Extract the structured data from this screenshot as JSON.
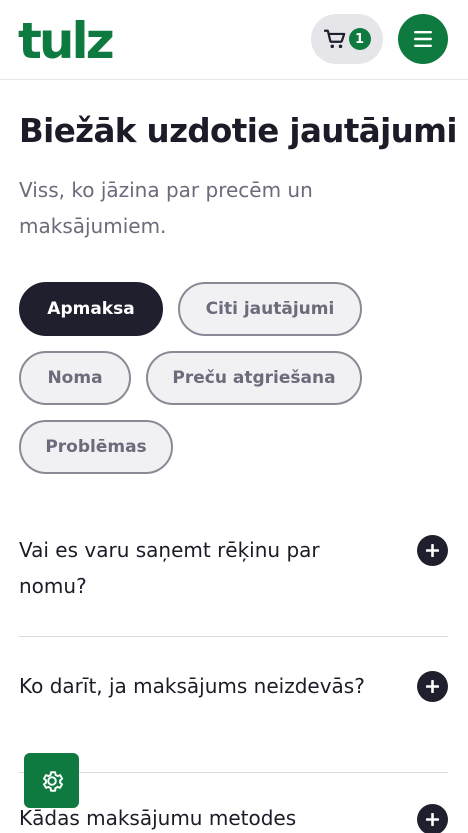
{
  "header": {
    "logo_text": "tulz",
    "cart": {
      "count": "1",
      "icon": "cart-icon"
    },
    "menu": {
      "icon": "hamburger-menu-icon"
    }
  },
  "page": {
    "title": "Biežāk uzdotie jautājumi",
    "subtitle": "Viss, ko jāzina par precēm un maksājumiem."
  },
  "categories": [
    {
      "label": "Apmaksa",
      "active": true
    },
    {
      "label": "Citi jautājumi",
      "active": false
    },
    {
      "label": "Noma",
      "active": false
    },
    {
      "label": "Preču atgriešana",
      "active": false
    },
    {
      "label": "Problēmas",
      "active": false
    }
  ],
  "faq": [
    {
      "question": "Vai es varu saņemt rēķinu par nomu?",
      "icon": "plus-icon"
    },
    {
      "question": "Ko darīt, ja maksājums neizdevās?",
      "icon": "plus-icon"
    },
    {
      "question": "Kādas maksājumu metodes",
      "icon": "plus-icon"
    }
  ],
  "settings_fab": {
    "icon": "gear-icon"
  },
  "colors": {
    "brand_green": "#0e7a3f",
    "dark": "#1f1f2e",
    "muted_text": "#6b6b7b",
    "chip_bg": "#f1f1f3",
    "chip_border": "#8a8a96"
  }
}
